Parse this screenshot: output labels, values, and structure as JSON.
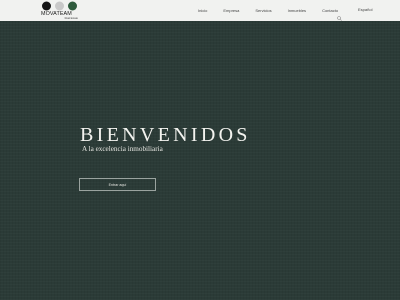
{
  "header": {
    "logo": {
      "name": "MOVATEAM",
      "sub": "Real Estate",
      "circle_colors": [
        "#151515",
        "#c9c9c9",
        "#2e5a3c"
      ]
    },
    "nav": [
      {
        "label": "Inicio"
      },
      {
        "label": "Empresa"
      },
      {
        "label": "Servicios"
      },
      {
        "label": "Inmuebles"
      },
      {
        "label": "Contacto"
      }
    ],
    "search_icon": "search-icon",
    "language": "Español"
  },
  "hero": {
    "title": "BIENVENIDOS",
    "subtitle": "A la excelencia inmobiliaria",
    "button_label": "Entrar aquí",
    "background_color": "#2b3b37"
  }
}
